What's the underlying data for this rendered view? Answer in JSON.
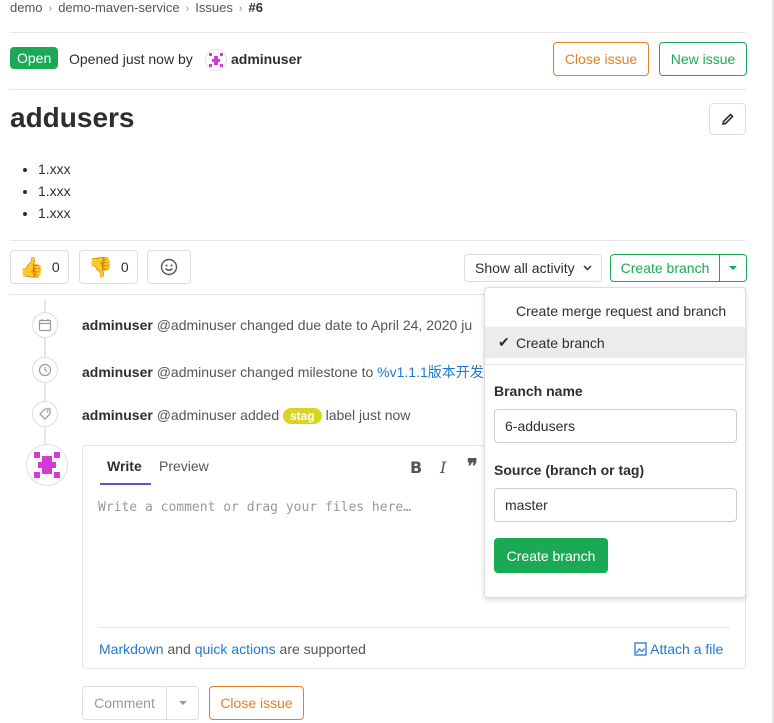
{
  "breadcrumb": {
    "items": [
      "demo",
      "demo-maven-service",
      "Issues",
      "#6"
    ]
  },
  "header": {
    "status": "Open",
    "opened_text": "Opened just now by",
    "author": "adminuser",
    "close_issue": "Close issue",
    "new_issue": "New issue"
  },
  "issue": {
    "title": "addusers",
    "items": [
      "1.xxx",
      "1.xxx",
      "1.xxx"
    ]
  },
  "awards": {
    "thumbsup_count": "0",
    "thumbsdown_count": "0"
  },
  "activity": {
    "filter_label": "Show all activity",
    "create_branch_label": "Create branch"
  },
  "timeline": [
    {
      "user": "adminuser",
      "text": "@adminuser changed due date to April 24, 2020 ju",
      "icon": "calendar-icon"
    },
    {
      "user": "adminuser",
      "text": "@adminuser changed milestone to ",
      "link": "%v1.1.1版本开发",
      "icon": "clock-icon"
    },
    {
      "user": "adminuser",
      "text": "@adminuser added ",
      "label": "stag",
      "after": " label just now",
      "icon": "tag-icon"
    }
  ],
  "comment": {
    "write_tab": "Write",
    "preview_tab": "Preview",
    "placeholder": "Write a comment or drag your files here…",
    "markdown_link": "Markdown",
    "and_text": " and ",
    "quick_actions_link": "quick actions",
    "supported_text": " are supported",
    "attach": "Attach a file",
    "comment_button": "Comment",
    "close_issue_button": "Close issue"
  },
  "dropdown": {
    "option1": "Create merge request and branch",
    "option2": "Create branch",
    "branch_name_label": "Branch name",
    "branch_name_value": "6-addusers",
    "source_label": "Source (branch or tag)",
    "source_value": "master",
    "submit": "Create branch"
  },
  "colors": {
    "green": "#1aaa55",
    "orange": "#e67e22",
    "link": "#1f78d1",
    "label_stag": "#d9d51f"
  }
}
